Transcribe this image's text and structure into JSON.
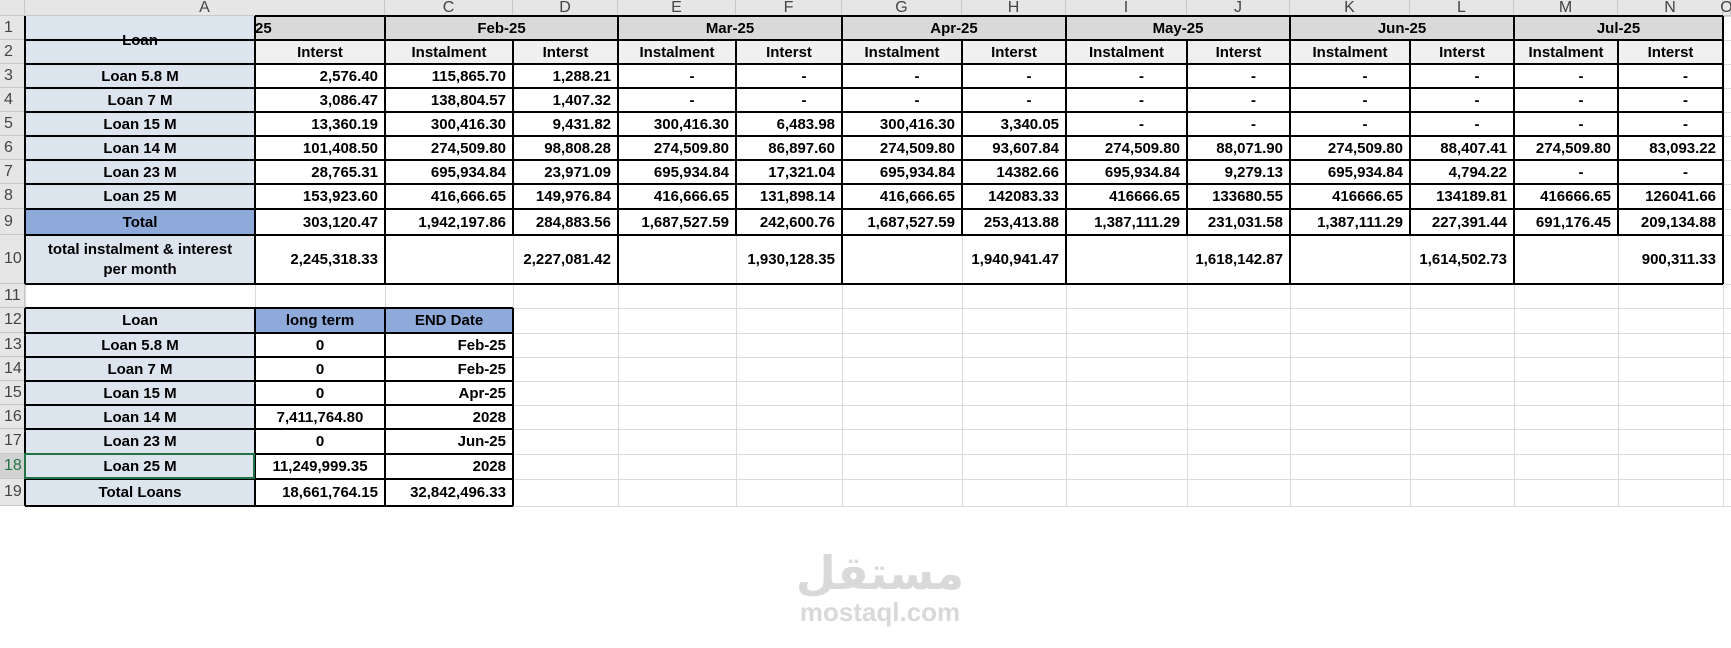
{
  "columns": [
    "A",
    "C",
    "D",
    "E",
    "F",
    "G",
    "H",
    "I",
    "J",
    "K",
    "L",
    "M",
    "N",
    "O"
  ],
  "rows": [
    "1",
    "2",
    "3",
    "4",
    "5",
    "6",
    "7",
    "8",
    "9",
    "10",
    "11",
    "12",
    "13",
    "14",
    "15",
    "16",
    "17",
    "18",
    "19"
  ],
  "selected_row": "18",
  "colors": {
    "loan_label_fill": "#dce4ee",
    "total_fill": "#8eaadb",
    "month_header_fill": "#d9d9d9",
    "sub_header_fill": "#f0f0f0",
    "summary_header_fill": "#8eaadb",
    "selected_outline": "#217346"
  },
  "table1": {
    "loan_header": "Loan",
    "month_headers": [
      "25",
      "Feb-25",
      "Mar-25",
      "Apr-25",
      "May-25",
      "Jun-25",
      "Jul-25"
    ],
    "sub_headers": [
      "Interst",
      "Instalment",
      "Interst",
      "Instalment",
      "Interst",
      "Instalment",
      "Interst",
      "Instalment",
      "Interst",
      "Instalment",
      "Interst",
      "Instalment",
      "Interst"
    ],
    "rows": [
      {
        "label": "Loan 5.8 M",
        "values": [
          "2,576.40",
          "115,865.70",
          "1,288.21",
          "-",
          "-",
          "-",
          "-",
          "-",
          "-",
          "-",
          "-",
          "-",
          "-"
        ]
      },
      {
        "label": "Loan 7 M",
        "values": [
          "3,086.47",
          "138,804.57",
          "1,407.32",
          "-",
          "-",
          "-",
          "-",
          "-",
          "-",
          "-",
          "-",
          "-",
          "-"
        ]
      },
      {
        "label": "Loan 15 M",
        "values": [
          "13,360.19",
          "300,416.30",
          "9,431.82",
          "300,416.30",
          "6,483.98",
          "300,416.30",
          "3,340.05",
          "-",
          "-",
          "-",
          "-",
          "-",
          "-"
        ]
      },
      {
        "label": "Loan 14 M",
        "values": [
          "101,408.50",
          "274,509.80",
          "98,808.28",
          "274,509.80",
          "86,897.60",
          "274,509.80",
          "93,607.84",
          "274,509.80",
          "88,071.90",
          "274,509.80",
          "88,407.41",
          "274,509.80",
          "83,093.22"
        ]
      },
      {
        "label": "Loan 23 M",
        "values": [
          "28,765.31",
          "695,934.84",
          "23,971.09",
          "695,934.84",
          "17,321.04",
          "695,934.84",
          "14382.66",
          "695,934.84",
          "9,279.13",
          "695,934.84",
          "4,794.22",
          "-",
          "-"
        ]
      },
      {
        "label": "Loan 25 M",
        "values": [
          "153,923.60",
          "416,666.65",
          "149,976.84",
          "416,666.65",
          "131,898.14",
          "416,666.65",
          "142083.33",
          "416666.65",
          "133680.55",
          "416666.65",
          "134189.81",
          "416666.65",
          "126041.66"
        ]
      }
    ],
    "total": {
      "label": "Total",
      "values": [
        "303,120.47",
        "1,942,197.86",
        "284,883.56",
        "1,687,527.59",
        "242,600.76",
        "1,687,527.59",
        "253,413.88",
        "1,387,111.29",
        "231,031.58",
        "1,387,111.29",
        "227,391.44",
        "691,176.45",
        "209,134.88"
      ]
    },
    "per_month": {
      "label_line1": "total instalment & interest",
      "label_line2": "per month",
      "values": [
        "2,245,318.33",
        "2,227,081.42",
        "1,930,128.35",
        "1,940,941.47",
        "1,618,142.87",
        "1,614,502.73",
        "900,311.33"
      ]
    }
  },
  "table2": {
    "headers": [
      "Loan",
      "long term",
      "END Date"
    ],
    "rows": [
      {
        "loan": "Loan 5.8 M",
        "long_term": "0",
        "end_date": "Feb-25"
      },
      {
        "loan": "Loan 7 M",
        "long_term": "0",
        "end_date": "Feb-25"
      },
      {
        "loan": "Loan 15 M",
        "long_term": "0",
        "end_date": "Apr-25"
      },
      {
        "loan": "Loan 14 M",
        "long_term": "7,411,764.80",
        "end_date": "2028"
      },
      {
        "loan": "Loan 23 M",
        "long_term": "0",
        "end_date": "Jun-25"
      },
      {
        "loan": "Loan 25 M",
        "long_term": "11,249,999.35",
        "end_date": "2028"
      }
    ],
    "total": {
      "loan": "Total Loans",
      "long_term": "18,661,764.15",
      "end_date": "32,842,496.33"
    }
  },
  "watermark": {
    "arabic": "مستقل",
    "latin": "mostaql.com"
  }
}
